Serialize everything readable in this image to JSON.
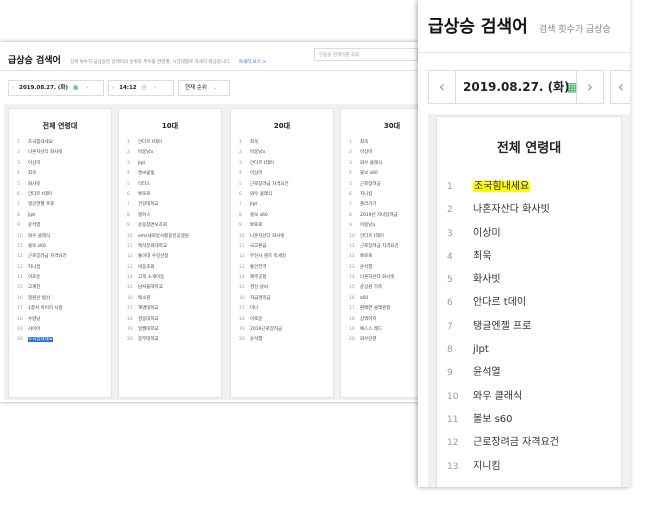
{
  "header": {
    "title": "급상승 검색어",
    "description": "검색 횟수가 급상승한 검색어의 순위와 추이를 연령별, 시간대별로 자세히 제공합니다.",
    "description_short": "검색 횟수가 급상승",
    "more_link": "자세히 보기 >",
    "search_placeholder": "인동승 검색어를 조회"
  },
  "controls": {
    "date": "2019.08.27. (화)",
    "time": "14:12",
    "sort": "현재 순위",
    "prev_icon": "chevron-left-icon",
    "next_icon": "chevron-right-icon",
    "calendar_icon": "calendar-icon",
    "clock_icon": "clock-icon"
  },
  "columns": [
    {
      "title": "전체 연령대",
      "items": [
        "조국힘내세요",
        "나혼자산다 화사빗",
        "이상미",
        "최욱",
        "화사빗",
        "안다르 t데이",
        "탱글엔젤 프로",
        "jlpt",
        "윤석열",
        "와우 클래식",
        "볼보 s60",
        "근로장려금 자격요건",
        "지니킴",
        "이로운",
        "고계진",
        "정원산 법산",
        "1층서 아이미 사랑",
        "수량남",
        "샤이어",
        "조국힘내세요"
      ],
      "highlight": [
        1,
        20
      ]
    },
    {
      "title": "10대",
      "items": [
        "안다르 t데이",
        "어몽냥a",
        "jlpt",
        "엔씨꽃빛",
        "닥터스",
        "뽀로로",
        "건강대학교",
        "앵커스",
        "운동장면보조회",
        "ems새희망사활동빈공생원",
        "백석문화대학교",
        "통이대 수강신청",
        "비동조회",
        "고객 소개이동",
        "남서울대학교",
        "백소원",
        "계명대학교",
        "경동대학교",
        "일월대학교",
        "중부대학교"
      ]
    },
    {
      "title": "20대",
      "items": [
        "최욱",
        "어몽냥a",
        "안다르 t데이",
        "이상미",
        "근로장려금 자격요건",
        "와우 클래식",
        "jlpt",
        "볼보 s60",
        "뽀로로",
        "나혼자산다 화사빗",
        "국고환급",
        "무신사 랜즈 빅세일",
        "통안전역",
        "제주공항",
        "경신 날씨",
        "저급경리금",
        "미나",
        "이로운",
        "2019근로장려금",
        "윤석열"
      ]
    },
    {
      "title": "30대",
      "items": [
        "최욱",
        "이상미",
        "와우 클래식",
        "볼보 s60",
        "근로장려금",
        "지니킴",
        "폴라기기",
        "2019년 자녀장려금",
        "어몽냥a",
        "안다르 t데이",
        "근로장려금 자격요건",
        "뽀로로",
        "윤석열",
        "나혼자산다 화사빗",
        "윤상원 가족",
        "s60",
        "판매연 클래원합",
        "삼백이지",
        "예스스 레드",
        "와우인챈"
      ]
    }
  ]
}
